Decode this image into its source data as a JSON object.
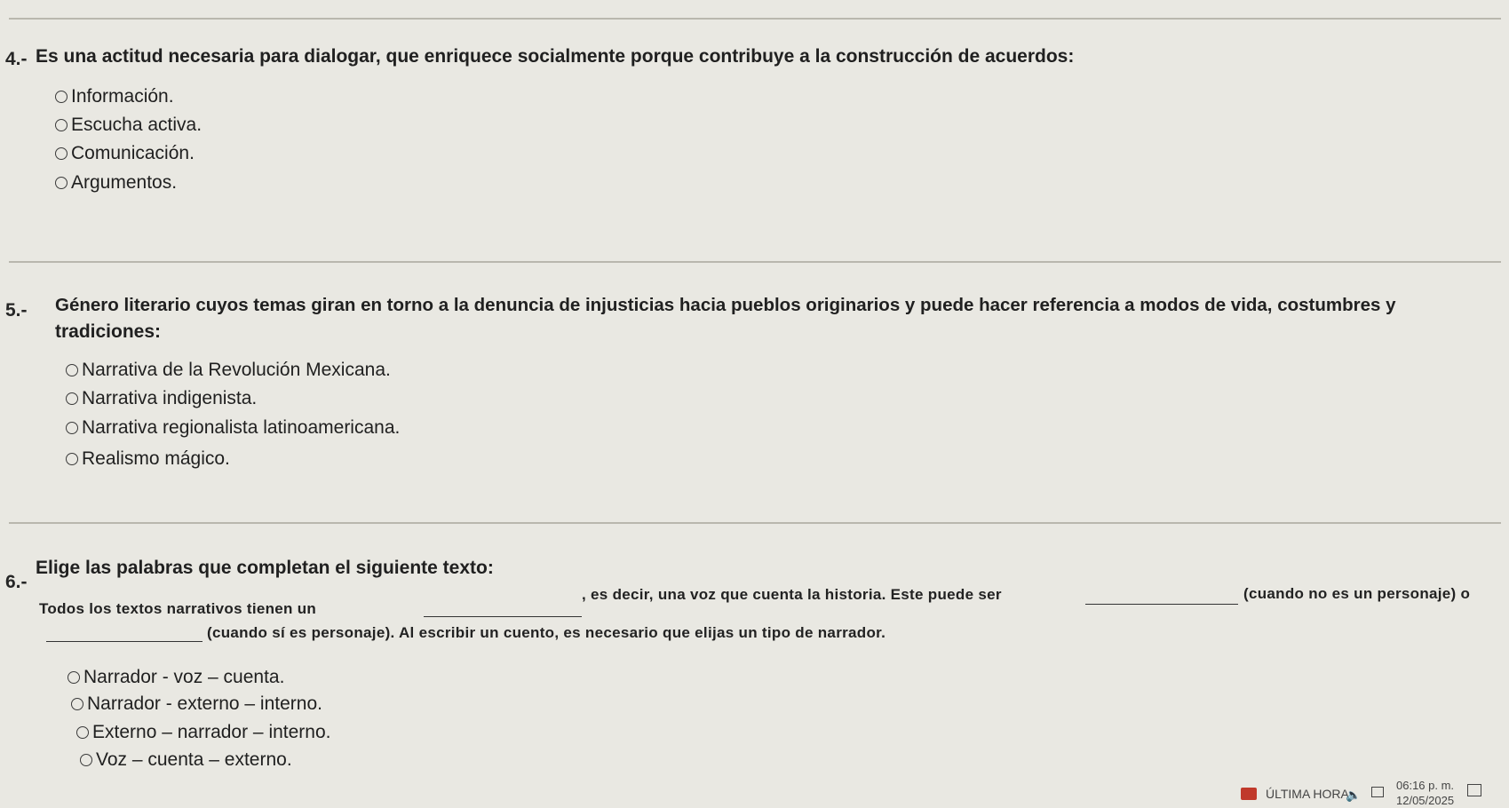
{
  "q4": {
    "number": "4.-",
    "text": "Es una actitud necesaria para dialogar, que enriquece socialmente porque contribuye a la construcción de acuerdos:",
    "options": [
      "Información.",
      "Escucha activa.",
      "Comunicación.",
      "Argumentos."
    ]
  },
  "q5": {
    "number": "5.-",
    "text_line1": "Género literario cuyos temas giran en torno a la denuncia de injusticias hacia pueblos originarios y puede hacer referencia a modos de vida, costumbres y",
    "text_line2": "tradiciones:",
    "options": [
      "Narrativa de la Revolución Mexicana.",
      "Narrativa indigenista.",
      "Narrativa regionalista latinoamericana.",
      "Realismo mágico."
    ]
  },
  "q6": {
    "number": "6.-",
    "text": "Elige las palabras que completan el siguiente texto:",
    "para_part1": "Todos los textos narrativos tienen un",
    "para_part2": ", es decir, una voz que cuenta la historia. Este puede ser",
    "para_part3": "(cuando no es un personaje) o",
    "para_part4": "(cuando sí es personaje). Al escribir un cuento, es necesario que elijas un tipo de narrador.",
    "options": [
      "Narrador - voz – cuenta.",
      "Narrador - externo – interno.",
      "Externo – narrador – interno.",
      "Voz – cuenta – externo."
    ]
  },
  "taskbar": {
    "news_label": "ÚLTIMA HORA",
    "time": "06:16 p. m.",
    "date": "12/05/2025",
    "icons": [
      "news-icon",
      "speaker-icon",
      "network-icon",
      "notification-icon"
    ]
  }
}
